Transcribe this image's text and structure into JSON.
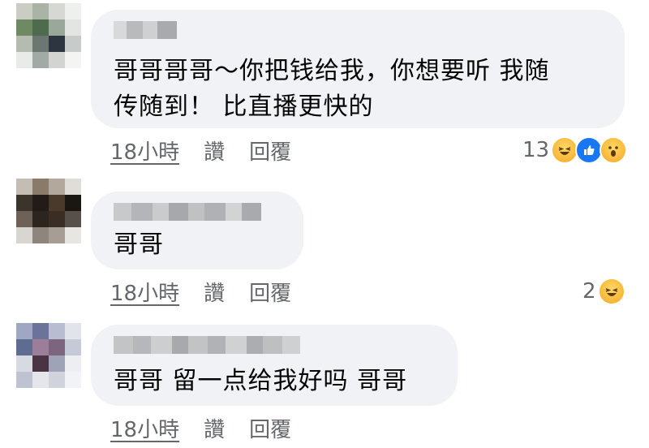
{
  "comments": [
    {
      "text": "哥哥哥哥～你把钱给我，你想要听 我随\n传随到！ 比直播更快的",
      "time": "18小時",
      "like_label": "讚",
      "reply_label": "回覆",
      "reaction_count": "13",
      "reactions": [
        "haha-icon",
        "like-icon",
        "wow-icon"
      ]
    },
    {
      "text": "哥哥",
      "time": "18小時",
      "like_label": "讚",
      "reply_label": "回覆",
      "reaction_count": "2",
      "reactions": [
        "haha-icon"
      ]
    },
    {
      "text": "哥哥 留一点给我好吗 哥哥",
      "time": "18小時",
      "like_label": "讚",
      "reply_label": "回覆",
      "reaction_count": "",
      "reactions": []
    }
  ],
  "colors": {
    "bubble": "#f0f2f5",
    "meta_text": "#65676b",
    "like_blue": "#1877f2"
  }
}
